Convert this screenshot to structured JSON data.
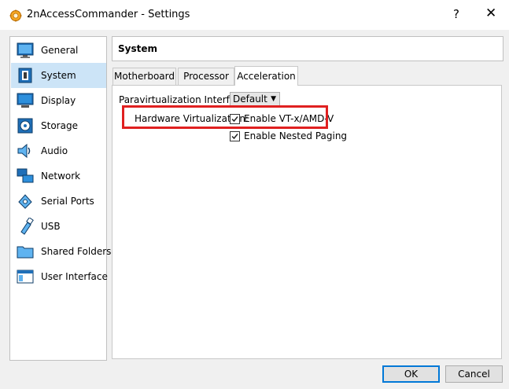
{
  "window": {
    "title": "2nAccessCommander - Settings",
    "help_glyph": "?",
    "close_glyph": "✕"
  },
  "sidebar": {
    "items": [
      {
        "label": "General",
        "icon": "general-icon"
      },
      {
        "label": "System",
        "icon": "system-icon",
        "selected": true
      },
      {
        "label": "Display",
        "icon": "display-icon"
      },
      {
        "label": "Storage",
        "icon": "storage-icon"
      },
      {
        "label": "Audio",
        "icon": "audio-icon"
      },
      {
        "label": "Network",
        "icon": "network-icon"
      },
      {
        "label": "Serial Ports",
        "icon": "serial-ports-icon"
      },
      {
        "label": "USB",
        "icon": "usb-icon"
      },
      {
        "label": "Shared Folders",
        "icon": "shared-folders-icon"
      },
      {
        "label": "User Interface",
        "icon": "user-interface-icon"
      }
    ]
  },
  "section": {
    "title": "System"
  },
  "tabs": [
    {
      "label": "Motherboard"
    },
    {
      "label": "Processor"
    },
    {
      "label": "Acceleration",
      "active": true
    }
  ],
  "acceleration": {
    "paravirt_label": "Paravirtualization Interface:",
    "paravirt_value": "Default",
    "hwvirt_label": "Hardware Virtualization:",
    "vtx_label": "Enable VT-x/AMD-V",
    "vtx_checked": true,
    "nested_label": "Enable Nested Paging",
    "nested_checked": true
  },
  "buttons": {
    "ok": "OK",
    "cancel": "Cancel"
  },
  "colors": {
    "selection": "#cce4f7",
    "highlight_box": "#e02020",
    "default_button_border": "#0078d7"
  }
}
